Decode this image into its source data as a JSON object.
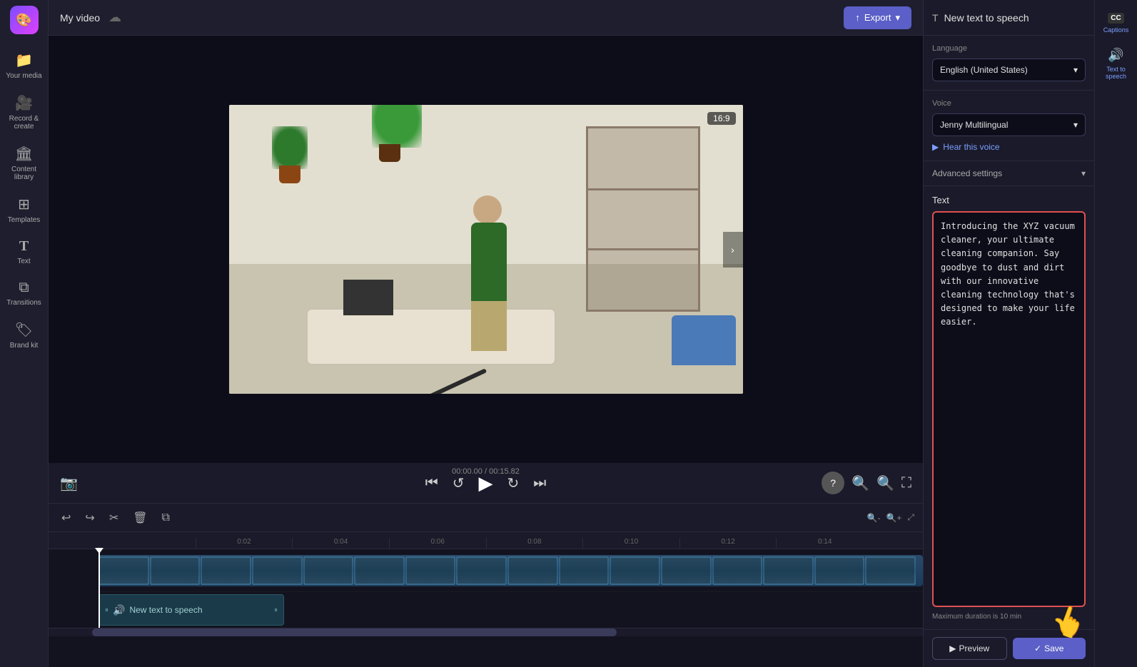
{
  "app": {
    "title": "My video",
    "logo_icon": "🎨"
  },
  "sidebar": {
    "items": [
      {
        "id": "your-media",
        "label": "Your media",
        "icon": "📁"
      },
      {
        "id": "record-create",
        "label": "Record &\ncreate",
        "icon": "🎥"
      },
      {
        "id": "content-library",
        "label": "Content library",
        "icon": "🏛"
      },
      {
        "id": "templates",
        "label": "Templates",
        "icon": "⊞"
      },
      {
        "id": "text",
        "label": "Text",
        "icon": "T"
      },
      {
        "id": "transitions",
        "label": "Transitions",
        "icon": "⧉"
      },
      {
        "id": "brand-kit",
        "label": "Brand kit",
        "icon": "🏷"
      }
    ]
  },
  "header": {
    "title": "My video",
    "export_label": "Export"
  },
  "video": {
    "aspect_ratio": "16:9"
  },
  "playback": {
    "current_time": "00:00.00",
    "total_time": "00:15.82"
  },
  "timeline": {
    "ruler_marks": [
      "0:02",
      "0:04",
      "0:06",
      "0:08",
      "0:10",
      "0:12",
      "0:14"
    ]
  },
  "tts_track": {
    "label": "New text to speech"
  },
  "right_panel": {
    "title": "New text to speech",
    "language_label": "Language",
    "language_value": "English (United States)",
    "voice_label": "Voice",
    "voice_value": "Jenny Multilingual",
    "hear_voice": "Hear this voice",
    "advanced_settings": "Advanced settings",
    "text_label": "Text",
    "text_content": "Introducing the XYZ vacuum cleaner, your ultimate cleaning companion. Say goodbye to dust and dirt with our innovative cleaning technology that's designed to make your life easier.",
    "max_duration": "Maximum duration is 10 min",
    "preview_label": "Preview",
    "save_label": "Save"
  },
  "captions_panel": {
    "captions_icon": "CC",
    "captions_label": "Captions",
    "tts_icon": "🔊",
    "tts_label": "Text to speech"
  }
}
